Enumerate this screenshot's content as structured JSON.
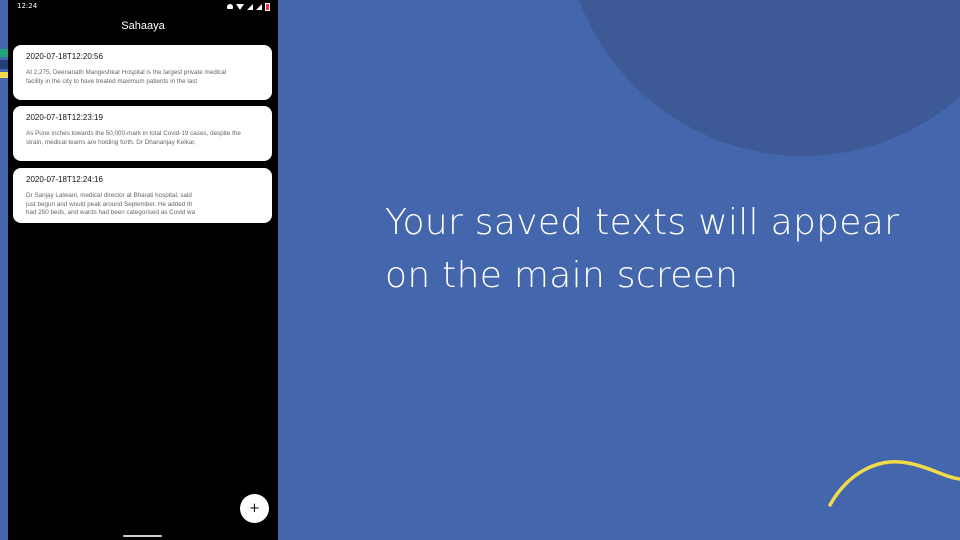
{
  "colors": {
    "background": "#4466AD",
    "blob": "#3D5A96",
    "wave": "#F2DA4A",
    "phone_background": "#000000",
    "card_background": "#FFFFFF",
    "edge_green": "#1FA37A",
    "edge_navy": "#243E78",
    "edge_yellow": "#F2DA4A"
  },
  "status_bar": {
    "time": "12:24",
    "icons": [
      "notification-icon",
      "wifi-icon",
      "signal-icon",
      "signal-icon",
      "battery-icon"
    ]
  },
  "app": {
    "title": "Sahaaya"
  },
  "notes": [
    {
      "date": "2020-07-18T12:20:56",
      "text": "At 2,275, Deenanath Mangeshkar Hospital is the largest private medical\nfacility in the city to have treated maximum patients in the last"
    },
    {
      "date": "2020-07-18T12:23:19",
      "text": "As Pune inches towards the 50,000-mark in total Covid-19 cases, despite the\nstrain, medical teams are holding forth. Dr Dhananjay Kelkar,"
    },
    {
      "date": "2020-07-18T12:24:16",
      "text": "Dr Sanjay Lalwani, medical director at Bharati hospital, said\njust begun and would peak around September. He added th\nhad 250 beds, and wards had been categorised as Covid wa"
    }
  ],
  "fab": {
    "label": "+",
    "icon": "plus-icon"
  },
  "caption": {
    "text": "Your saved texts will appear on the main screen"
  }
}
